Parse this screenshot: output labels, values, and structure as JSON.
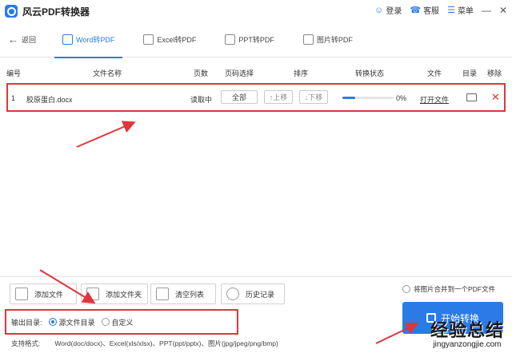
{
  "app": {
    "title": "风云PDF转换器",
    "actions": [
      {
        "label": "登录",
        "icon": "user-icon"
      },
      {
        "label": "客服",
        "icon": "headset-icon"
      },
      {
        "label": "菜单",
        "icon": "menu-icon"
      }
    ]
  },
  "nav": {
    "back_label": "返回",
    "tabs": [
      {
        "label": "Word转PDF",
        "active": true
      },
      {
        "label": "Excel转PDF",
        "active": false
      },
      {
        "label": "PPT转PDF",
        "active": false
      },
      {
        "label": "图片转PDF",
        "active": false
      }
    ]
  },
  "table": {
    "headers": {
      "index": "编号",
      "filename": "文件名称",
      "pages": "页数",
      "page_select": "页码选择",
      "order": "排序",
      "status": "转换状态",
      "file": "文件",
      "folder": "目录",
      "remove": "移除"
    },
    "rows": [
      {
        "index": "1",
        "filename": "胶原蛋白.docx",
        "pages": "读取中",
        "page_select": "全部",
        "move_up": "↑上移",
        "move_down": "↓下移",
        "progress": 0.25,
        "progress_text": "0%",
        "open_file": "打开文件"
      }
    ]
  },
  "actions": {
    "add_file": "添加文件",
    "add_folder": "添加文件夹",
    "clear_list": "清空列表",
    "history": "历史记录",
    "merge_images": "将图片合并到一个PDF文件"
  },
  "output": {
    "label": "输出目录:",
    "source_option": "源文件目录",
    "custom_option": "自定义",
    "selected": "source"
  },
  "convert": {
    "label": "开始转换"
  },
  "formats": {
    "label": "支持格式:",
    "text": "Word(doc/docx)、Excel(xls/xlsx)、PPT(ppt/pptx)、图片(jpg/jpeg/png/bmp)"
  },
  "watermark": {
    "big": "经验总结",
    "small": "jingyanzongjie.com"
  },
  "colors": {
    "accent": "#2a7be8",
    "highlight": "#e0353d"
  }
}
